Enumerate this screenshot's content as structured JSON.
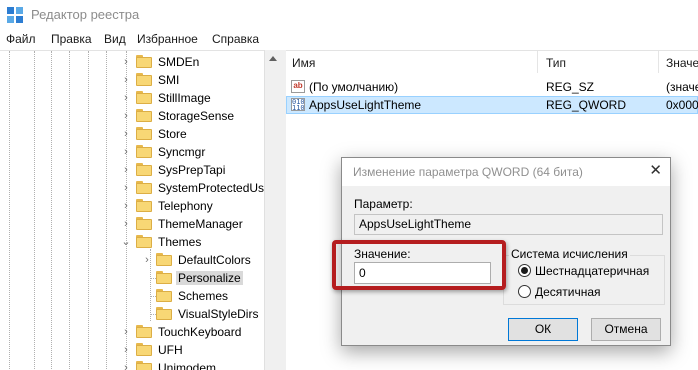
{
  "window": {
    "title": "Редактор реестра",
    "icon": "registry-editor-icon"
  },
  "menu": {
    "items": [
      "Файл",
      "Правка",
      "Вид",
      "Избранное",
      "Справка"
    ]
  },
  "tree": {
    "items": [
      {
        "label": "SMDEn",
        "expanded": false
      },
      {
        "label": "SMI",
        "expanded": false
      },
      {
        "label": "StillImage",
        "expanded": false
      },
      {
        "label": "StorageSense",
        "expanded": false
      },
      {
        "label": "Store",
        "expanded": false
      },
      {
        "label": "Syncmgr",
        "expanded": false
      },
      {
        "label": "SysPrepTapi",
        "expanded": false
      },
      {
        "label": "SystemProtectedUs",
        "expanded": false
      },
      {
        "label": "Telephony",
        "expanded": false
      },
      {
        "label": "ThemeManager",
        "expanded": false
      },
      {
        "label": "Themes",
        "expanded": true
      },
      {
        "label": "DefaultColors",
        "expanded": false
      },
      {
        "label": "Personalize",
        "selected": true
      },
      {
        "label": "Schemes"
      },
      {
        "label": "VisualStyleDirs"
      },
      {
        "label": "TouchKeyboard",
        "expanded": false
      },
      {
        "label": "UFH",
        "expanded": false
      },
      {
        "label": "Unimodem",
        "expanded": false
      }
    ]
  },
  "list": {
    "columns": [
      "Имя",
      "Тип",
      "Значе"
    ],
    "rows": [
      {
        "name": "(По умолчанию)",
        "type": "REG_SZ",
        "value": "(значе",
        "icon": "string-value-icon"
      },
      {
        "name": "AppsUseLightTheme",
        "type": "REG_QWORD",
        "value": "0x0000",
        "icon": "binary-value-icon",
        "selected": true
      }
    ]
  },
  "dialog": {
    "title": "Изменение параметра QWORD (64 бита)",
    "param_label": "Параметр:",
    "param_value": "AppsUseLightTheme",
    "value_label": "Значение:",
    "value_input": "0",
    "base_group_label": "Система исчисления",
    "radio_hex": "Шестнадцатеричная",
    "radio_dec": "Десятичная",
    "selected_base": "hex",
    "ok_label": "ОК",
    "cancel_label": "Отмена",
    "close_glyph": "✕"
  },
  "colors": {
    "highlight": "#b51d1f",
    "selection": "#cce8ff",
    "folder": "#f8d775"
  }
}
